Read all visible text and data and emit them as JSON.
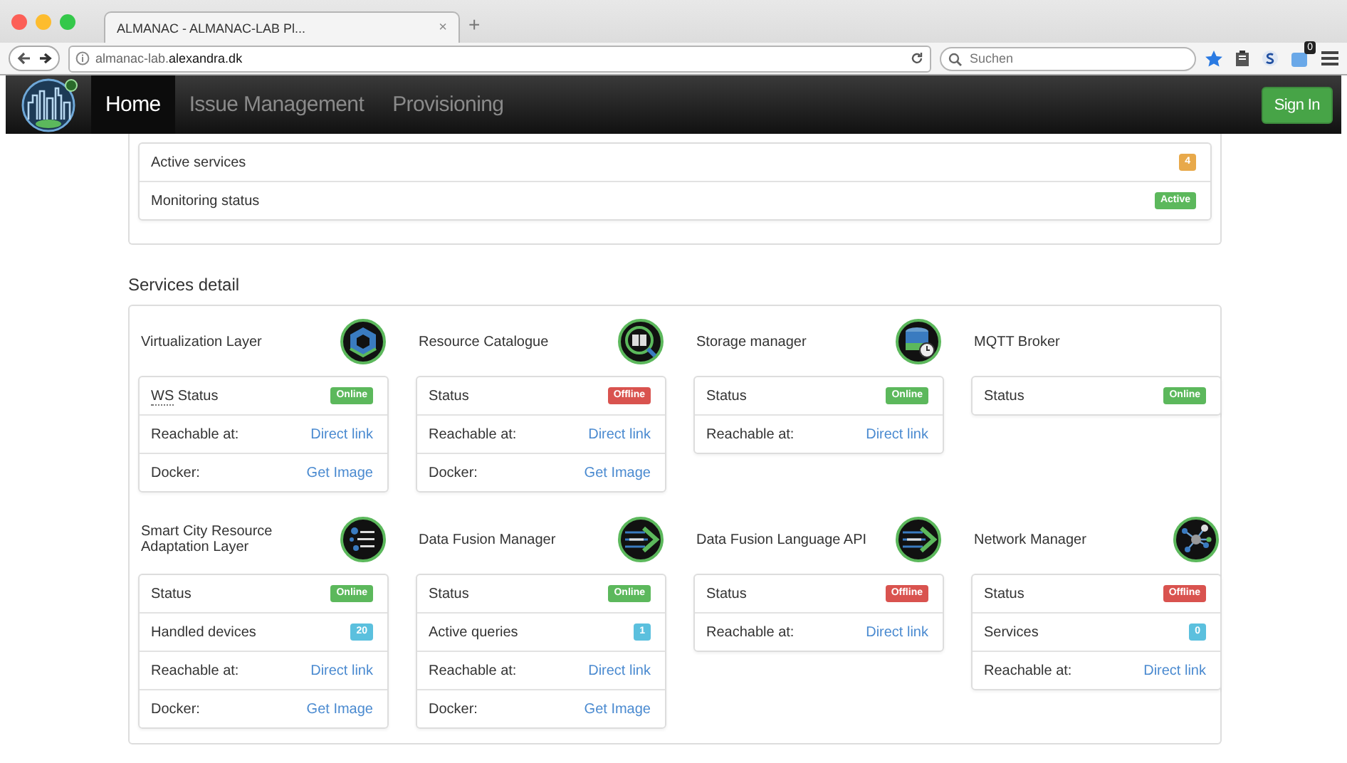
{
  "browser": {
    "tab": {
      "title": "ALMANAC - ALMANAC-LAB Pl...",
      "close": "×",
      "selected": true
    },
    "new_tab": "+",
    "address": "almanac-lab.**alexandra.dk**",
    "search": {
      "placeholder": "Suchen"
    },
    "notification_count": "0"
  },
  "navbar": {
    "items": [
      {
        "label": "Home",
        "selected": true
      },
      {
        "label": "Issue Management",
        "selected": false
      },
      {
        "label": "Provisioning",
        "selected": false
      }
    ],
    "sign_in": "Sign In"
  },
  "summary": {
    "rows": [
      {
        "label": "Active services",
        "badge": "4",
        "color": "#e8a94a"
      },
      {
        "label": "Monitoring status",
        "badge": "Active",
        "color": "#5cb85c"
      }
    ]
  },
  "services_title": "Services detail",
  "services": [
    {
      "name": "Virtualization Layer",
      "rows": [
        {
          "kind": "badge",
          "abbr": "WS",
          "label": "Status",
          "badge": "Online",
          "color": "#5cb85c"
        },
        {
          "kind": "link",
          "label": "Reachable at:",
          "link": "Direct link"
        },
        {
          "kind": "link",
          "label": "Docker:",
          "link": "Get Image"
        }
      ]
    },
    {
      "name": "Resource Catalogue",
      "rows": [
        {
          "kind": "badge",
          "label": "Status",
          "badge": "Offline",
          "color": "#d9534f"
        },
        {
          "kind": "link",
          "label": "Reachable at:",
          "link": "Direct link"
        },
        {
          "kind": "link",
          "label": "Docker:",
          "link": "Get Image"
        }
      ]
    },
    {
      "name": "Storage manager",
      "rows": [
        {
          "kind": "badge",
          "label": "Status",
          "badge": "Online",
          "color": "#5cb85c"
        },
        {
          "kind": "link",
          "label": "Reachable at:",
          "link": "Direct link"
        }
      ]
    },
    {
      "name": "MQTT Broker",
      "rows": [
        {
          "kind": "badge",
          "label": "Status",
          "badge": "Online",
          "color": "#5cb85c"
        }
      ]
    },
    {
      "name": "Smart City Resource Adaptation Layer",
      "rows": [
        {
          "kind": "badge",
          "label": "Status",
          "badge": "Online",
          "color": "#5cb85c"
        },
        {
          "kind": "badge",
          "label": "Handled devices",
          "badge": "20",
          "color": "#5bc0de"
        },
        {
          "kind": "link",
          "label": "Reachable at:",
          "link": "Direct link"
        },
        {
          "kind": "link",
          "label": "Docker:",
          "link": "Get Image"
        }
      ]
    },
    {
      "name": "Data Fusion Manager",
      "rows": [
        {
          "kind": "badge",
          "label": "Status",
          "badge": "Online",
          "color": "#5cb85c"
        },
        {
          "kind": "badge",
          "label": "Active queries",
          "badge": "1",
          "color": "#5bc0de"
        },
        {
          "kind": "link",
          "label": "Reachable at:",
          "link": "Direct link"
        },
        {
          "kind": "link",
          "label": "Docker:",
          "link": "Get Image"
        }
      ]
    },
    {
      "name": "Data Fusion Language API",
      "rows": [
        {
          "kind": "badge",
          "label": "Status",
          "badge": "Offline",
          "color": "#d9534f"
        },
        {
          "kind": "link",
          "label": "Reachable at:",
          "link": "Direct link"
        }
      ]
    },
    {
      "name": "Network Manager",
      "rows": [
        {
          "kind": "badge",
          "label": "Status",
          "badge": "Offline",
          "color": "#d9534f"
        },
        {
          "kind": "badge",
          "label": "Services",
          "badge": "0",
          "color": "#5bc0de"
        },
        {
          "kind": "link",
          "label": "Reachable at:",
          "link": "Direct link"
        }
      ]
    }
  ]
}
